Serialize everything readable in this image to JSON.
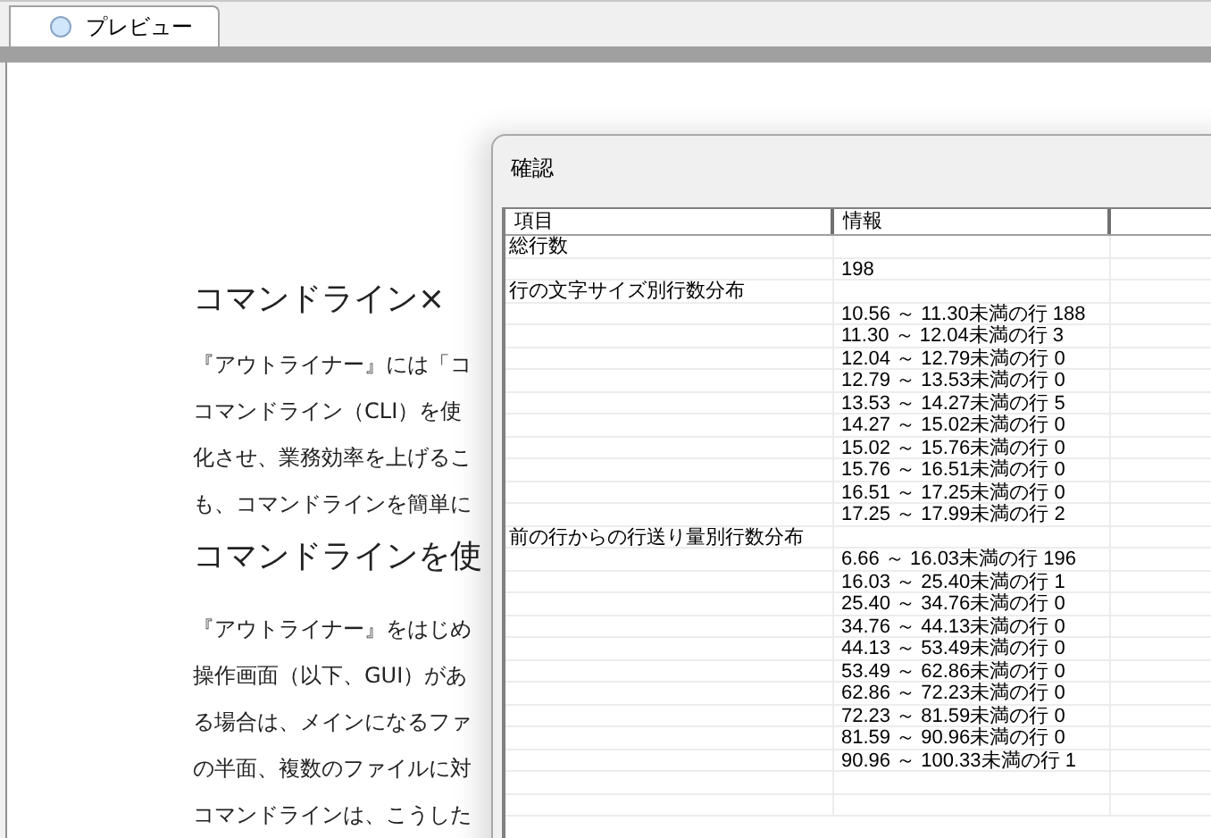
{
  "tabs": [
    {
      "label": "プレビュー",
      "selected": true
    }
  ],
  "document": {
    "blocks": [
      {
        "kind": "heading",
        "text": "コマンドライン×"
      },
      {
        "kind": "paragraph",
        "lines": [
          "『アウトライナー』には「コ",
          "コマンドライン（CLI）を使",
          "化させ、業務効率を上げるこ",
          "も、コマンドラインを簡単に"
        ]
      },
      {
        "kind": "heading",
        "text": "コマンドラインを使"
      },
      {
        "kind": "paragraph",
        "lines": [
          "『アウトライナー』をはじめ",
          "操作画面（以下、GUI）があ",
          "る場合は、メインになるファ",
          "の半面、複数のファイルに対",
          "コマンドラインは、こうした"
        ]
      }
    ]
  },
  "dialog": {
    "title": "確認",
    "table": {
      "columns": [
        "項目",
        "情報"
      ],
      "rows": [
        [
          "総行数",
          ""
        ],
        [
          "",
          "198"
        ],
        [
          "行の文字サイズ別行数分布",
          ""
        ],
        [
          "",
          "10.56 ～ 11.30未満の行 188"
        ],
        [
          "",
          "11.30 ～ 12.04未満の行 3"
        ],
        [
          "",
          "12.04 ～ 12.79未満の行 0"
        ],
        [
          "",
          "12.79 ～ 13.53未満の行 0"
        ],
        [
          "",
          "13.53 ～ 14.27未満の行 5"
        ],
        [
          "",
          "14.27 ～ 15.02未満の行 0"
        ],
        [
          "",
          "15.02 ～ 15.76未満の行 0"
        ],
        [
          "",
          "15.76 ～ 16.51未満の行 0"
        ],
        [
          "",
          "16.51 ～ 17.25未満の行 0"
        ],
        [
          "",
          "17.25 ～ 17.99未満の行 2"
        ],
        [
          "前の行からの行送り量別行数分布",
          ""
        ],
        [
          "",
          "6.66 ～ 16.03未満の行 196"
        ],
        [
          "",
          "16.03 ～ 25.40未満の行 1"
        ],
        [
          "",
          "25.40 ～ 34.76未満の行 0"
        ],
        [
          "",
          "34.76 ～ 44.13未満の行 0"
        ],
        [
          "",
          "44.13 ～ 53.49未満の行 0"
        ],
        [
          "",
          "53.49 ～ 62.86未満の行 0"
        ],
        [
          "",
          "62.86 ～ 72.23未満の行 0"
        ],
        [
          "",
          "72.23 ～ 81.59未満の行 0"
        ],
        [
          "",
          "81.59 ～ 90.96未満の行 0"
        ],
        [
          "",
          "90.96 ～ 100.33未満の行 1"
        ]
      ]
    }
  }
}
